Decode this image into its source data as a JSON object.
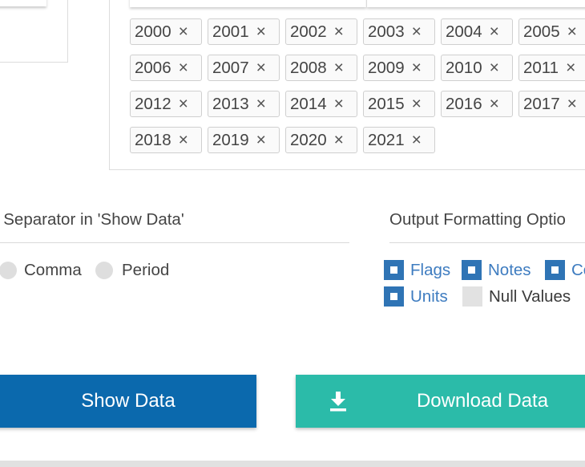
{
  "years": [
    "2000",
    "2001",
    "2002",
    "2003",
    "2004",
    "2005",
    "2006",
    "2007",
    "2008",
    "2009",
    "2010",
    "2011",
    "2012",
    "2013",
    "2014",
    "2015",
    "2016",
    "2017",
    "2018",
    "2019",
    "2020",
    "2021"
  ],
  "chip_remove_glyph": "×",
  "separator": {
    "title": "l Separator in 'Show Data'",
    "options": [
      "Comma",
      "Period"
    ]
  },
  "output": {
    "title": "Output Formatting Optio",
    "options": [
      {
        "label": "Flags",
        "checked": true
      },
      {
        "label": "Notes",
        "checked": true
      },
      {
        "label": "Co",
        "checked": true
      },
      {
        "label": "Units",
        "checked": true
      },
      {
        "label": "Null Values",
        "checked": false
      }
    ]
  },
  "buttons": {
    "show": "Show Data",
    "download": "Download Data",
    "download_icon": "download-icon"
  },
  "colors": {
    "show_button": "#0b69ad",
    "download_button": "#2bbba9",
    "checkbox_checked": "#2f74b5",
    "link_label": "#3e7cc0"
  }
}
